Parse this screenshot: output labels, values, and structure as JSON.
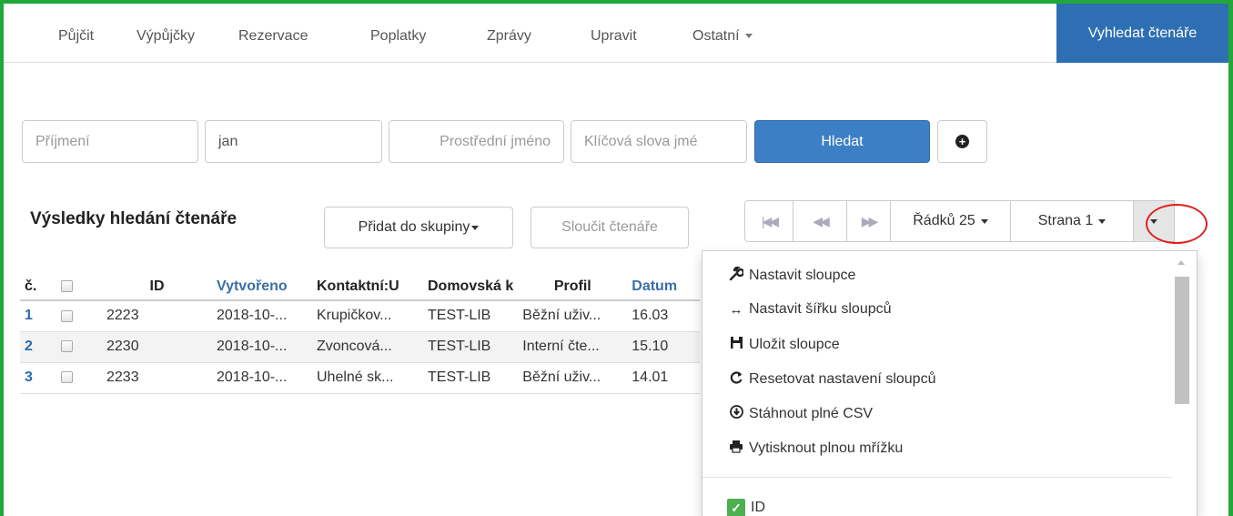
{
  "nav": {
    "items": [
      "Půjčit",
      "Výpůjčky",
      "Rezervace",
      "Poplatky",
      "Zprávy",
      "Upravit",
      "Ostatní"
    ],
    "search_patron_label": "Vyhledat čtenáře"
  },
  "search": {
    "surname_placeholder": "Příjmení",
    "first_name_value": "jan",
    "middle_name_placeholder": "Prostřední jméno",
    "keywords_placeholder": "Klíčová slova jmé",
    "search_button": "Hledat"
  },
  "results": {
    "title": "Výsledky hledání čtenáře",
    "add_to_group": "Přidat do skupiny",
    "merge_patrons": "Sloučit čtenáře",
    "rows_label": "Řádků 25",
    "page_label": "Strana 1"
  },
  "table": {
    "headers": [
      "č.",
      "",
      "ID",
      "Vytvořeno",
      "Kontaktní:U",
      "Domovská k",
      "Profil",
      "Datum"
    ],
    "rows": [
      {
        "num": "1",
        "id": "2223",
        "created": "2018-10-...",
        "contact": "Krupičkov...",
        "home": "TEST-LIB",
        "profile": "Běžní uživ...",
        "date": "16.03"
      },
      {
        "num": "2",
        "id": "2230",
        "created": "2018-10-...",
        "contact": "Zvoncová...",
        "home": "TEST-LIB",
        "profile": "Interní čte...",
        "date": "15.10"
      },
      {
        "num": "3",
        "id": "2233",
        "created": "2018-10-...",
        "contact": "Uhelné sk...",
        "home": "TEST-LIB",
        "profile": "Běžní uživ...",
        "date": "14.01"
      }
    ]
  },
  "dropdown": {
    "items": [
      {
        "icon": "wrench-icon",
        "label": "Nastavit sloupce"
      },
      {
        "icon": "horizontal-arrows-icon",
        "label": "Nastavit šířku sloupců"
      },
      {
        "icon": "save-icon",
        "label": "Uložit sloupce"
      },
      {
        "icon": "refresh-icon",
        "label": "Resetovat nastavení sloupců"
      },
      {
        "icon": "download-circle-icon",
        "label": "Stáhnout plné CSV"
      },
      {
        "icon": "print-icon",
        "label": "Vytisknout plnou mřížku"
      }
    ],
    "column_toggle": {
      "label": "ID",
      "checked": true
    }
  }
}
